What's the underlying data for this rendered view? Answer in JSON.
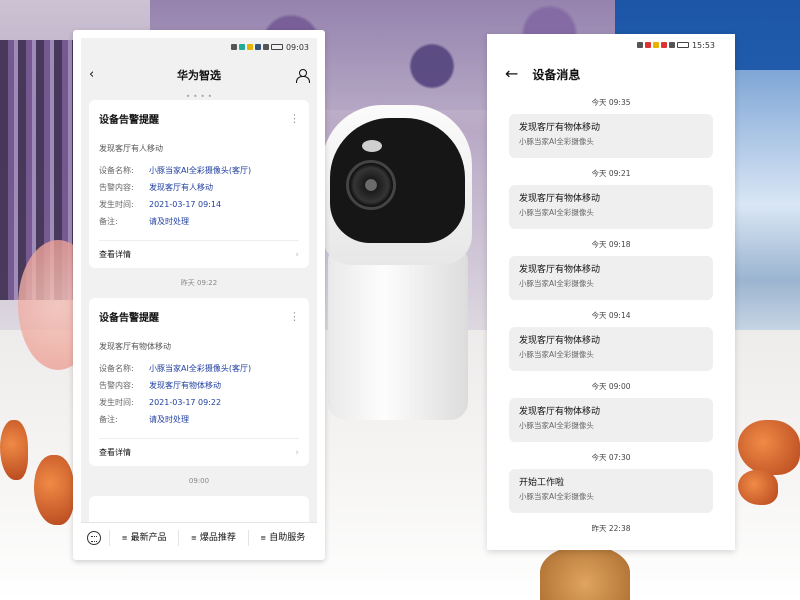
{
  "left_phone": {
    "status_time": "09:03",
    "header_title": "华为智选",
    "cards": [
      {
        "title": "设备告警提醒",
        "subtitle": "发现客厅有人移动",
        "rows": [
          {
            "key": "设备名称:",
            "value": "小豚当家AI全彩摄像头(客厅)"
          },
          {
            "key": "告警内容:",
            "value": "发现客厅有人移动"
          },
          {
            "key": "发生时间:",
            "value": "2021-03-17 09:14"
          },
          {
            "key": "备注:",
            "value": "请及时处理"
          }
        ],
        "footer": "查看详情"
      },
      {
        "title": "设备告警提醒",
        "subtitle": "发现客厅有物体移动",
        "rows": [
          {
            "key": "设备名称:",
            "value": "小豚当家AI全彩摄像头(客厅)"
          },
          {
            "key": "告警内容:",
            "value": "发现客厅有物体移动"
          },
          {
            "key": "发生时间:",
            "value": "2021-03-17 09:22"
          },
          {
            "key": "备注:",
            "value": "请及时处理"
          }
        ],
        "footer": "查看详情"
      }
    ],
    "separators": [
      "昨天 09:22",
      "09:00"
    ],
    "bottom_nav": [
      "最新产品",
      "爆品推荐",
      "自助服务"
    ]
  },
  "right_phone": {
    "status_time": "15:53",
    "header_title": "设备消息",
    "messages": [
      {
        "time": "今天 09:35",
        "title": "发现客厅有物体移动",
        "sub": "小豚当家AI全彩摄像头"
      },
      {
        "time": "今天 09:21",
        "title": "发现客厅有物体移动",
        "sub": "小豚当家AI全彩摄像头"
      },
      {
        "time": "今天 09:18",
        "title": "发现客厅有物体移动",
        "sub": "小豚当家AI全彩摄像头"
      },
      {
        "time": "今天 09:14",
        "title": "发现客厅有物体移动",
        "sub": "小豚当家AI全彩摄像头"
      },
      {
        "time": "今天 09:00",
        "title": "发现客厅有物体移动",
        "sub": "小豚当家AI全彩摄像头"
      },
      {
        "time": "今天 07:30",
        "title": "开始工作啦",
        "sub": "小豚当家AI全彩摄像头"
      }
    ],
    "last_time": "昨天 22:38"
  }
}
